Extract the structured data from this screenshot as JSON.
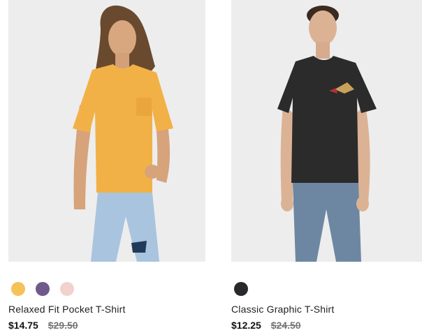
{
  "products": [
    {
      "name": "Relaxed Fit Pocket T-Shirt",
      "sale_price": "$14.75",
      "original_price": "$29.50",
      "image_alt": "Relaxed Fit Pocket T-Shirt",
      "swatches": [
        {
          "color": "#f5c25a",
          "icon": "orange-swatch"
        },
        {
          "color": "#6f5a8a",
          "icon": "purple-swatch"
        },
        {
          "color": "#f2d2cd",
          "icon": "pink-swatch"
        }
      ]
    },
    {
      "name": "Classic Graphic T-Shirt",
      "sale_price": "$12.25",
      "original_price": "$24.50",
      "image_alt": "Classic Graphic T-Shirt",
      "swatches": [
        {
          "color": "#27292d",
          "icon": "black-swatch"
        }
      ]
    }
  ],
  "colors": {
    "background": "#ffffff",
    "photo_background": "#ededed",
    "original_price": "#757575"
  }
}
